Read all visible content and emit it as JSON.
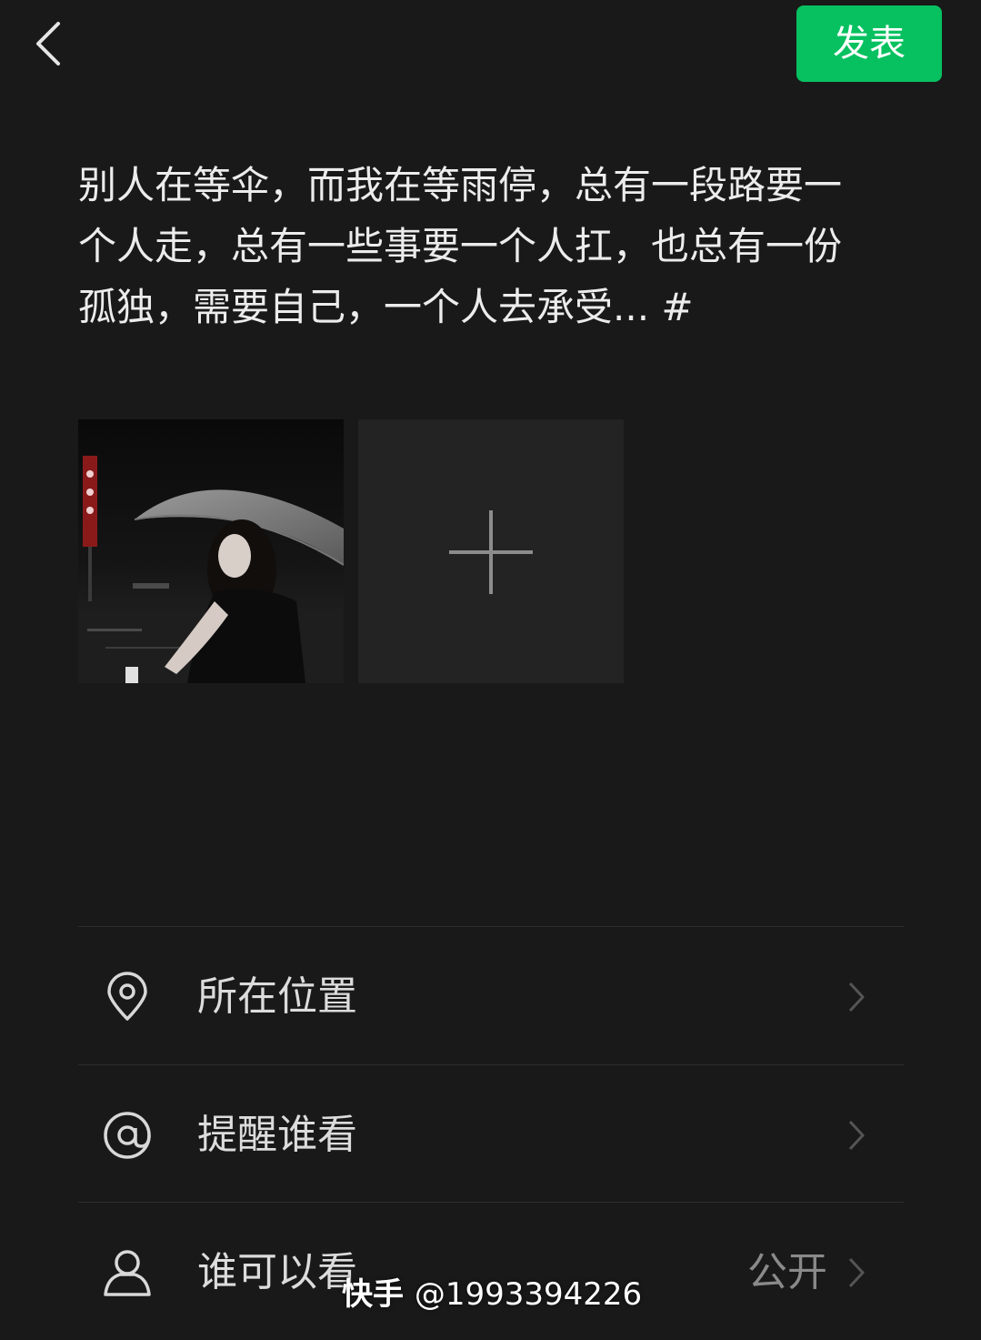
{
  "header": {
    "back_icon": "chevron-left-icon",
    "publish_label": "发表",
    "publish_color": "#07c160"
  },
  "post": {
    "text": "别人在等伞，而我在等雨停，总有一段路要一个人走，总有一些事要一个人扛，也总有一份孤独，需要自己，一个人去承受... #"
  },
  "photos": {
    "thumbnail_icon": "photo-thumbnail",
    "add_icon": "plus-icon"
  },
  "options": [
    {
      "icon": "location-pin-icon",
      "label": "所在位置",
      "value": ""
    },
    {
      "icon": "at-sign-icon",
      "label": "提醒谁看",
      "value": ""
    },
    {
      "icon": "person-icon",
      "label": "谁可以看",
      "value": "公开"
    }
  ],
  "watermark": {
    "brand": "快手",
    "handle": "@1993394226"
  }
}
